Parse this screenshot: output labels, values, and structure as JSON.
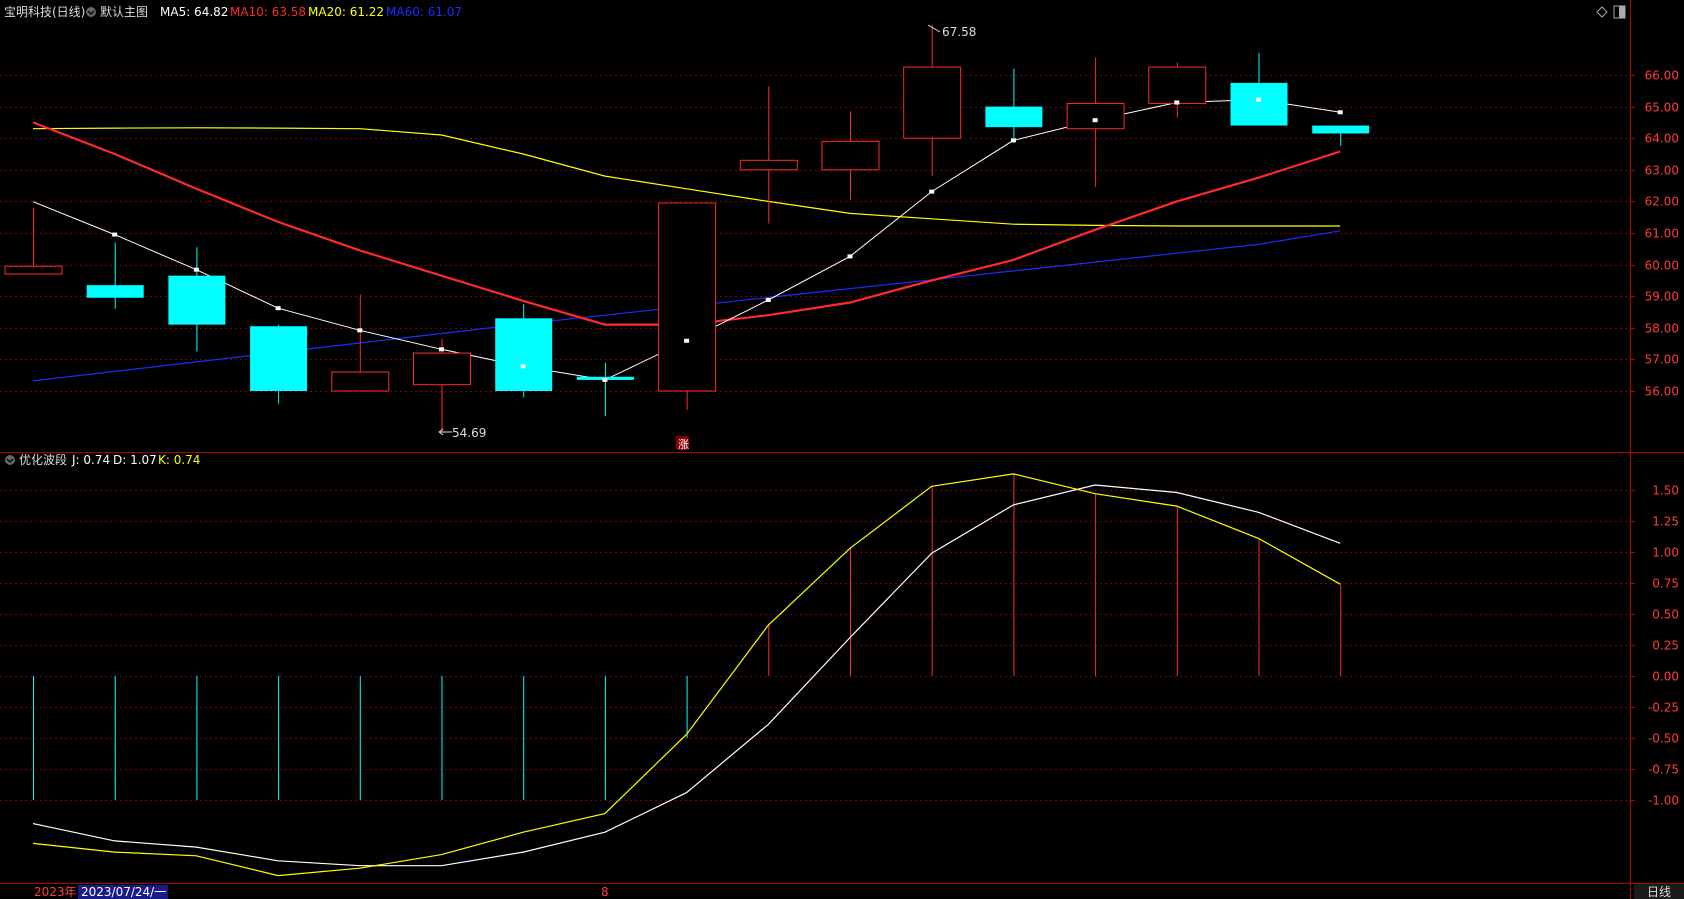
{
  "header": {
    "stock": "宝明科技(日线)",
    "template": "默认主图",
    "ma5": {
      "label": "MA5: 64.82",
      "color": "#ffffff"
    },
    "ma10": {
      "label": "MA10: 63.58",
      "color": "#ff2a2a"
    },
    "ma20": {
      "label": "MA20: 61.22",
      "color": "#ffff00"
    },
    "ma60": {
      "label": "MA60: 61.07",
      "color": "#1d2cff"
    }
  },
  "sub_header": {
    "indicator": "优化波段",
    "j": {
      "label": "J: 0.74",
      "color": "#ffffff"
    },
    "d": {
      "label": "D: 1.07",
      "color": "#ffffff"
    },
    "k": {
      "label": "K: 0.74",
      "color": "#ffff00"
    }
  },
  "top_right_icons": [
    "diamond-icon",
    "panel-toggle-icon"
  ],
  "markers": {
    "high_label": "67.58",
    "low_label": "54.69",
    "zhang_label": "涨"
  },
  "footer": {
    "year": "2023年",
    "date": "2023/07/24/一",
    "month": "8",
    "period": "日线"
  },
  "colors": {
    "up": "#ff2a2a",
    "down": "#00ffff",
    "grid": "#7a0000",
    "axis_text": "#ff3b3b"
  },
  "chart_data": [
    {
      "type": "candlestick",
      "ylim": [
        54.69,
        67.58
      ],
      "y_ticks": [
        "66.00",
        "65.00",
        "64.00",
        "63.00",
        "62.00",
        "61.00",
        "60.00",
        "59.00",
        "58.00",
        "57.00",
        "56.00"
      ],
      "candles": [
        {
          "o": 59.7,
          "h": 61.8,
          "l": 59.7,
          "c": 59.95
        },
        {
          "o": 59.35,
          "h": 60.7,
          "l": 58.6,
          "c": 58.95
        },
        {
          "o": 59.65,
          "h": 60.55,
          "l": 57.25,
          "c": 58.1
        },
        {
          "o": 58.05,
          "h": 58.1,
          "l": 55.6,
          "c": 56.0
        },
        {
          "o": 56.0,
          "h": 59.05,
          "l": 56.0,
          "c": 56.6
        },
        {
          "o": 56.2,
          "h": 57.65,
          "l": 54.69,
          "c": 57.2
        },
        {
          "o": 58.3,
          "h": 58.75,
          "l": 55.8,
          "c": 56.0
        },
        {
          "o": 56.45,
          "h": 56.9,
          "l": 55.2,
          "c": 56.35
        },
        {
          "o": 56.0,
          "h": 61.95,
          "l": 55.4,
          "c": 61.95
        },
        {
          "o": 63.0,
          "h": 65.65,
          "l": 61.3,
          "c": 63.3
        },
        {
          "o": 63.0,
          "h": 64.85,
          "l": 62.05,
          "c": 63.9
        },
        {
          "o": 64.0,
          "h": 67.58,
          "l": 62.8,
          "c": 66.25
        },
        {
          "o": 65.0,
          "h": 66.2,
          "l": 64.0,
          "c": 64.35
        },
        {
          "o": 64.3,
          "h": 66.55,
          "l": 62.45,
          "c": 65.1
        },
        {
          "o": 65.1,
          "h": 66.4,
          "l": 64.65,
          "c": 66.25
        },
        {
          "o": 65.75,
          "h": 66.7,
          "l": 64.4,
          "c": 64.4
        },
        {
          "o": 64.4,
          "h": 64.4,
          "l": 63.75,
          "c": 64.15
        }
      ],
      "series": [
        {
          "name": "MA5",
          "color": "#ffffff",
          "values": [
            61.99,
            60.95,
            59.84,
            58.62,
            57.92,
            57.32,
            56.78,
            56.35,
            57.59,
            58.88,
            60.26,
            62.31,
            63.93,
            64.57,
            65.13,
            65.22,
            64.82
          ]
        },
        {
          "name": "MA10",
          "color": "#ff2a2a",
          "values": [
            64.5,
            null,
            null,
            null,
            null,
            null,
            null,
            null,
            58.1,
            null,
            null,
            null,
            null,
            null,
            null,
            null,
            63.58
          ]
        },
        {
          "name": "MA20",
          "color": "#ffff00",
          "values": [
            64.3,
            64.32,
            64.33,
            64.32,
            64.3,
            64.1,
            63.5,
            62.8,
            62.4,
            62.0,
            61.62,
            61.45,
            61.28,
            61.24,
            61.22,
            61.22,
            61.22
          ]
        },
        {
          "name": "MA60",
          "color": "#1d2cff",
          "values": [
            56.32,
            null,
            null,
            null,
            null,
            null,
            null,
            null,
            null,
            null,
            null,
            null,
            null,
            null,
            null,
            null,
            61.07
          ]
        }
      ],
      "ma10_full": [
        64.5,
        63.5,
        62.4,
        61.35,
        60.45,
        59.65,
        58.85,
        58.1,
        58.1,
        58.4,
        58.8,
        59.5,
        60.15,
        61.1,
        62.0,
        62.75,
        63.58
      ],
      "ma60_full": [
        56.32,
        56.62,
        56.92,
        57.22,
        57.52,
        57.82,
        58.12,
        58.4,
        58.68,
        58.96,
        59.24,
        59.52,
        59.8,
        60.08,
        60.36,
        60.64,
        61.07
      ]
    },
    {
      "type": "line",
      "ylim": [
        -1.5,
        1.75
      ],
      "y_ticks": [
        "1.50",
        "1.25",
        "1.00",
        "0.75",
        "0.50",
        "0.25",
        "0.00",
        "-0.25",
        "-0.50",
        "-0.75",
        "-1.00"
      ],
      "series": [
        {
          "name": "J",
          "color": "#ffffff",
          "values": [
            -1.19,
            -1.33,
            -1.38,
            -1.49,
            -1.53,
            -1.53,
            -1.42,
            -1.26,
            -0.94,
            -0.39,
            0.31,
            0.99,
            1.38,
            1.54,
            1.48,
            1.32,
            1.07
          ]
        },
        {
          "name": "K",
          "color": "#ffff00",
          "values": [
            -1.35,
            -1.42,
            -1.45,
            -1.61,
            -1.55,
            -1.44,
            -1.26,
            -1.11,
            -0.47,
            0.41,
            1.03,
            1.53,
            1.63,
            1.47,
            1.37,
            1.11,
            0.74
          ]
        }
      ],
      "bars": [
        -1,
        -1,
        -1,
        -1,
        -1,
        -1,
        -1,
        -1,
        -0.5,
        0.41,
        1.03,
        1.53,
        1.63,
        1.47,
        1.37,
        1.11,
        0.74
      ]
    }
  ]
}
